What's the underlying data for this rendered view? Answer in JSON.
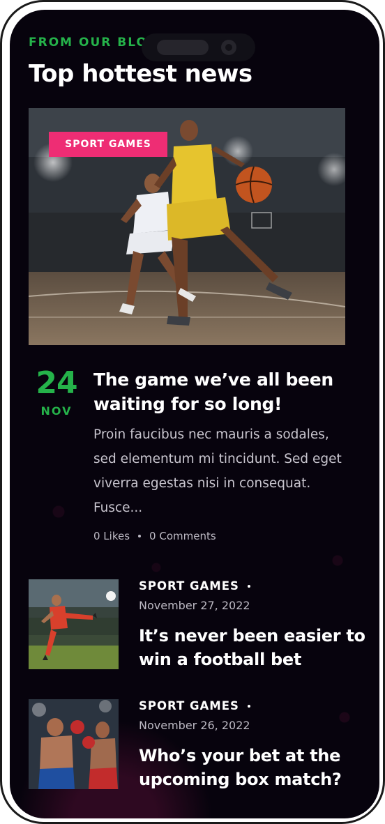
{
  "blog": {
    "eyebrow": "FROM OUR BLOG",
    "title": "Top hottest news"
  },
  "featured": {
    "category": "SPORT GAMES",
    "day": "24",
    "month": "NOV",
    "title": "The game we’ve all been waiting for so long!",
    "excerpt": "Proin faucibus nec mauris a sodales, sed elementum mi tincidunt. Sed eget viverra egestas nisi in consequat. Fusce...",
    "likes": "0 Likes",
    "comments": "0 Comments"
  },
  "posts": [
    {
      "category": "SPORT GAMES",
      "date": "November 27, 2022",
      "title": "It’s never been easier to win a football bet"
    },
    {
      "category": "SPORT GAMES",
      "date": "November 26, 2022",
      "title": "Who’s your bet at the upcoming box match?"
    }
  ],
  "colors": {
    "accent_green": "#25b24a",
    "badge_pink": "#ee2d74",
    "background": "#07030d"
  }
}
